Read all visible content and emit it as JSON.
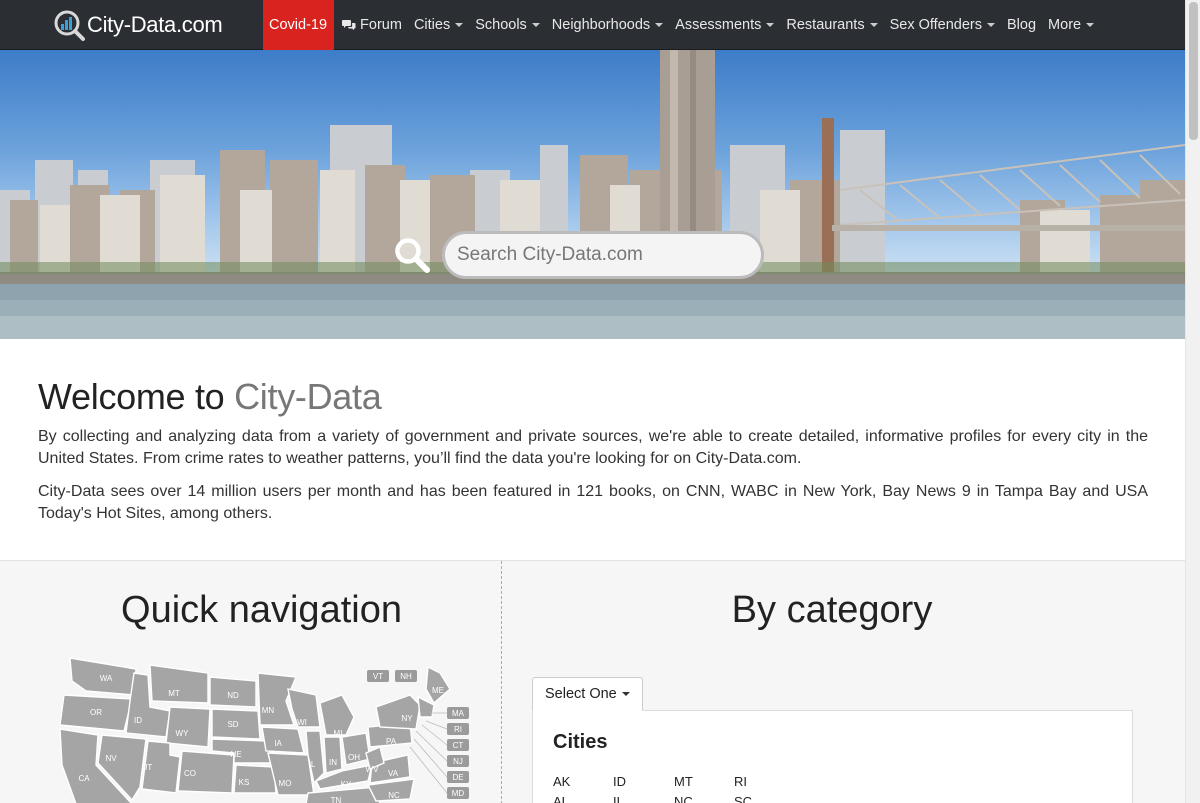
{
  "brand": {
    "logo_text": "City-Data.com",
    "accent": "#d9231f",
    "nav_bg": "#2b2f33"
  },
  "nav": {
    "items": [
      {
        "label": "Covid-19",
        "has_caret": false
      },
      {
        "label": "Forum",
        "has_caret": false,
        "icon": "chat-bubbles-icon"
      },
      {
        "label": "Cities",
        "has_caret": true
      },
      {
        "label": "Schools",
        "has_caret": true
      },
      {
        "label": "Neighborhoods",
        "has_caret": true
      },
      {
        "label": "Assessments",
        "has_caret": true
      },
      {
        "label": "Restaurants",
        "has_caret": true
      },
      {
        "label": "Sex Offenders",
        "has_caret": true
      },
      {
        "label": "Blog",
        "has_caret": false
      },
      {
        "label": "More",
        "has_caret": true
      }
    ]
  },
  "search": {
    "placeholder": "Search City-Data.com",
    "icon": "search-icon"
  },
  "welcome": {
    "title_prefix": "Welcome to ",
    "title_brand": "City-Data",
    "p1": "By collecting and analyzing data from a variety of government and private sources, we're able to create detailed, informative profiles for every city in the United States. From crime rates to weather patterns, you’ll find the data you're looking for on City-Data.com.",
    "p2": "City-Data sees over 14 million users per month and has been featured in 121 books, on CNN, WABC in New York, Bay News 9 in Tampa Bay and USA Today's Hot Sites, among others."
  },
  "quick_nav": {
    "title": "Quick navigation",
    "map_labels": [
      "WA",
      "OR",
      "CA",
      "ID",
      "NV",
      "MT",
      "WY",
      "UT",
      "CO",
      "ND",
      "SD",
      "NE",
      "KS",
      "MN",
      "IA",
      "MO",
      "WI",
      "IL",
      "MI",
      "IN",
      "OH",
      "KY",
      "TN",
      "NC",
      "VA",
      "WV",
      "PA",
      "NY",
      "ME",
      "VT",
      "NH",
      "MA",
      "RI",
      "CT",
      "NJ",
      "DE",
      "MD"
    ]
  },
  "by_category": {
    "title": "By category",
    "select_label": "Select One",
    "panel_title": "Cities",
    "states": [
      "AK",
      "ID",
      "MT",
      "RI",
      "AL",
      "IL",
      "NC",
      "SC"
    ]
  }
}
